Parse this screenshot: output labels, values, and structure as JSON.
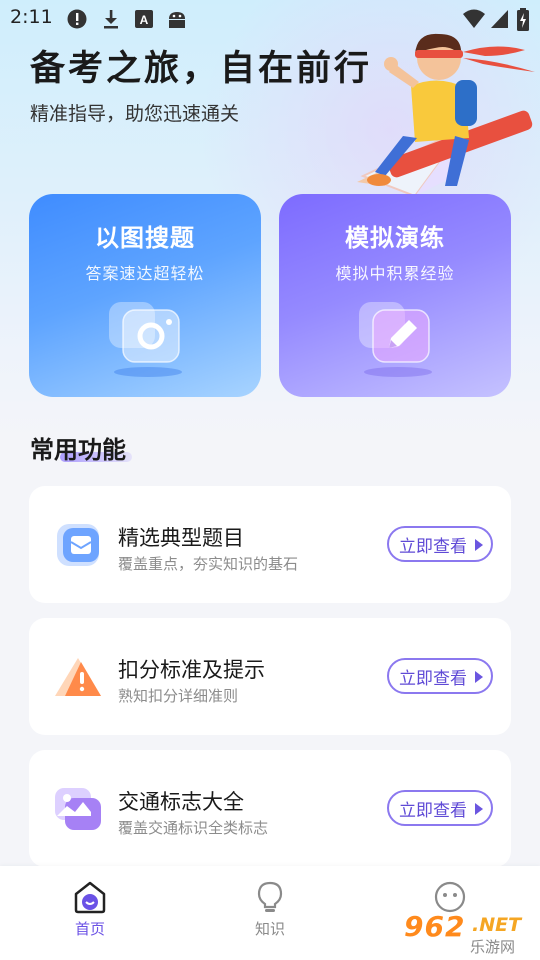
{
  "status_bar": {
    "time": "2:11",
    "left_icons": [
      "alert-icon",
      "download-icon",
      "a-badge-icon",
      "android-icon"
    ],
    "right_icons": [
      "wifi-icon",
      "signal-icon",
      "battery-charging-icon"
    ]
  },
  "hero": {
    "title": "备考之旅，自在前行",
    "subtitle": "精准指导，助您迅速通关"
  },
  "feature_cards": [
    {
      "title": "以图搜题",
      "subtitle": "答案速达超轻松",
      "icon": "camera-icon",
      "color": "#3f8cff"
    },
    {
      "title": "模拟演练",
      "subtitle": "模拟中积累经验",
      "icon": "pencil-icon",
      "color": "#7d6bff"
    }
  ],
  "section": {
    "title": "常用功能"
  },
  "list": [
    {
      "title": "精选典型题目",
      "desc": "覆盖重点，夯实知识的基石",
      "button": "立即查看",
      "icon": "mail-icon"
    },
    {
      "title": "扣分标准及提示",
      "desc": "熟知扣分详细准则",
      "button": "立即查看",
      "icon": "warning-icon"
    },
    {
      "title": "交通标志大全",
      "desc": "覆盖交通标识全类标志",
      "button": "立即查看",
      "icon": "image-icon"
    }
  ],
  "bottom_nav": [
    {
      "label": "首页",
      "icon": "home-icon",
      "active": true
    },
    {
      "label": "知识",
      "icon": "lightbulb-icon",
      "active": false
    },
    {
      "label": "",
      "icon": "smiley-icon",
      "active": false
    }
  ],
  "watermark": {
    "number": "962",
    "suffix": ".NET",
    "text": "乐游网"
  },
  "colors": {
    "accent": "#6b52e6",
    "search_card": "#3f8cff",
    "practice_card": "#7d6bff"
  }
}
